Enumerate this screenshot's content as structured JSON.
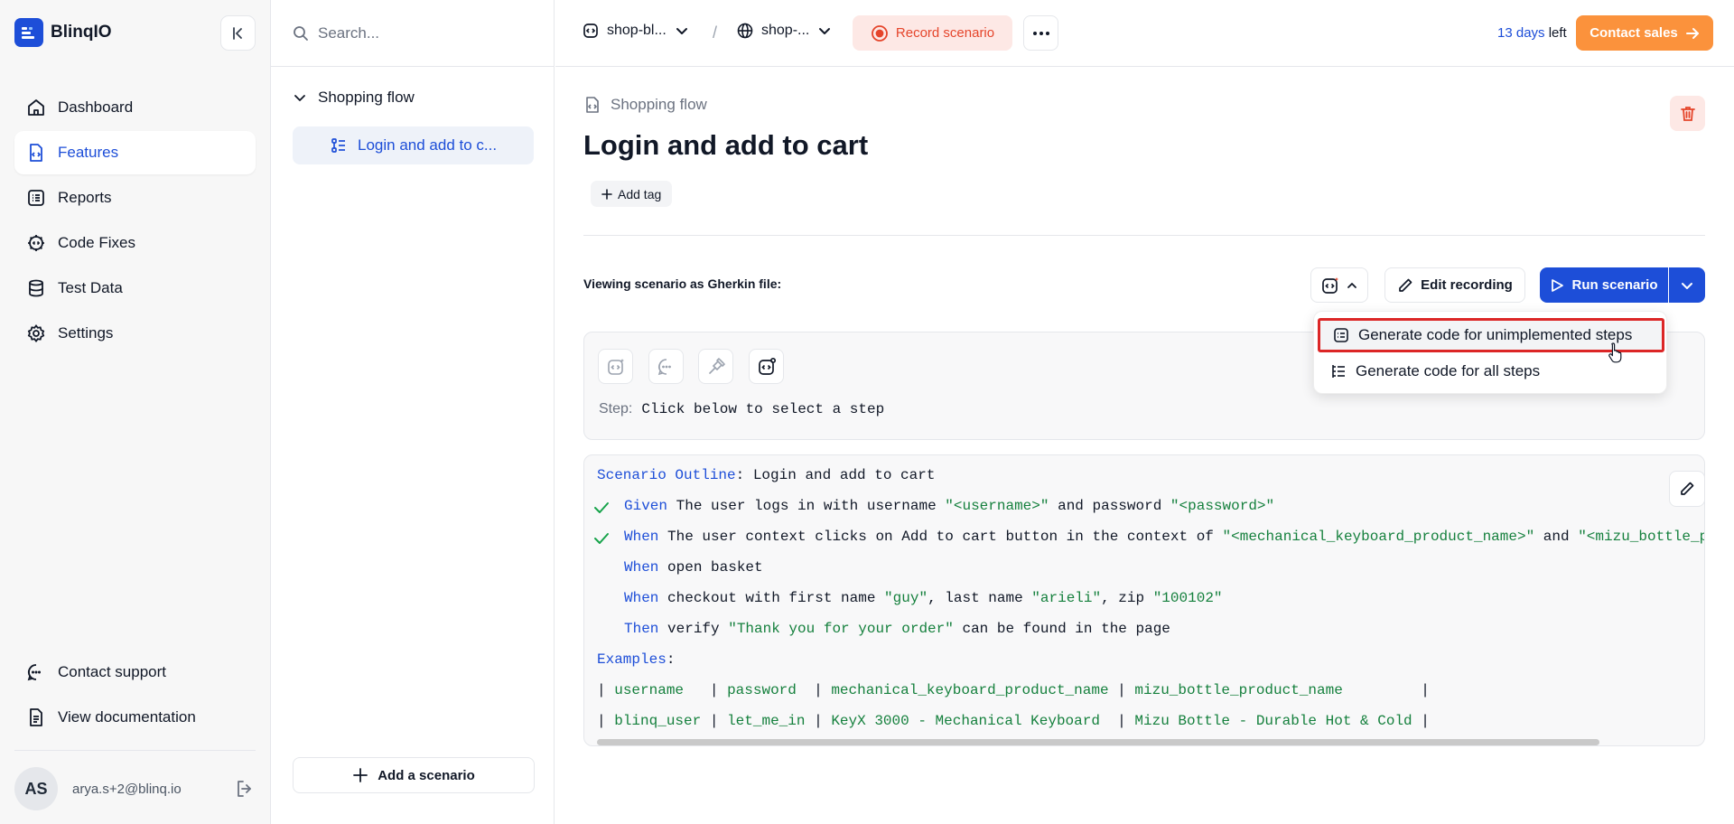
{
  "app": {
    "name": "BlinqIO"
  },
  "sidebar": {
    "items": [
      {
        "label": "Dashboard",
        "icon": "home-icon"
      },
      {
        "label": "Features",
        "icon": "feature-file-icon",
        "active": true
      },
      {
        "label": "Reports",
        "icon": "list-icon"
      },
      {
        "label": "Code Fixes",
        "icon": "gear-code-icon"
      },
      {
        "label": "Test Data",
        "icon": "database-icon"
      },
      {
        "label": "Settings",
        "icon": "gear-icon"
      }
    ],
    "bottom": [
      {
        "label": "Contact support",
        "icon": "chat-icon"
      },
      {
        "label": "View documentation",
        "icon": "document-icon"
      }
    ],
    "user": {
      "initials": "AS",
      "email": "arya.s+2@blinq.io"
    }
  },
  "middle": {
    "search_placeholder": "Search...",
    "feature": "Shopping flow",
    "scenario": "Login and add to c...",
    "add_scenario": "Add a scenario"
  },
  "topbar": {
    "project": "shop-bl...",
    "environment": "shop-...",
    "separator": "/",
    "record": "Record scenario",
    "trial_days": "13 days",
    "trial_suffix": " left",
    "contact_sales": "Contact sales"
  },
  "scenario": {
    "parent": "Shopping flow",
    "title": "Login and add to cart",
    "add_tag": "Add tag",
    "viewing_label": "Viewing scenario as Gherkin file:",
    "edit_recording": "Edit recording",
    "run": "Run scenario",
    "step_label": "Step:",
    "step_value": "Click below to select a step"
  },
  "menu": {
    "items": [
      {
        "label": "Generate code for unimplemented steps",
        "highlighted": true
      },
      {
        "label": "Generate code for all steps"
      }
    ]
  },
  "gherkin": {
    "l1_kw": "Scenario Outline",
    "l1_rest": ": Login and add to cart",
    "l2_kw": "Given",
    "l2_a": " The user logs in with username ",
    "l2_s1": "\"<username>\"",
    "l2_b": " and password ",
    "l2_s2": "\"<password>\"",
    "l3_kw": "When",
    "l3_a": " The user context clicks on Add to cart button in the context of ",
    "l3_s1": "\"<mechanical_keyboard_product_name>\"",
    "l3_b": " and ",
    "l3_s2": "\"<mizu_bottle_p",
    "l4_kw": "When",
    "l4_a": " open basket",
    "l5_kw": "When",
    "l5_a": " checkout with first name ",
    "l5_s1": "\"guy\"",
    "l5_b": ", last name ",
    "l5_s2": "\"arieli\"",
    "l5_c": ", zip ",
    "l5_s3": "\"100102\"",
    "l6_kw": "Then",
    "l6_a": " verify ",
    "l6_s1": "\"Thank you for your order\"",
    "l6_b": " can be found in the page",
    "l7_kw": "Examples",
    "l7_rest": ":",
    "table_header": [
      "username  ",
      "password ",
      "mechanical_keyboard_product_name",
      "mizu_bottle_product_name        "
    ],
    "table_row": [
      "blinq_user",
      "let_me_in",
      "KeyX 3000 - Mechanical Keyboard ",
      "Mizu Bottle - Durable Hot & Cold"
    ],
    "pipe": "|"
  },
  "colors": {
    "primary": "#1d4ed8",
    "record": "#e5452b",
    "contact_sales": "#fb923c",
    "string": "#15803d",
    "highlight_border": "#dc2626"
  }
}
